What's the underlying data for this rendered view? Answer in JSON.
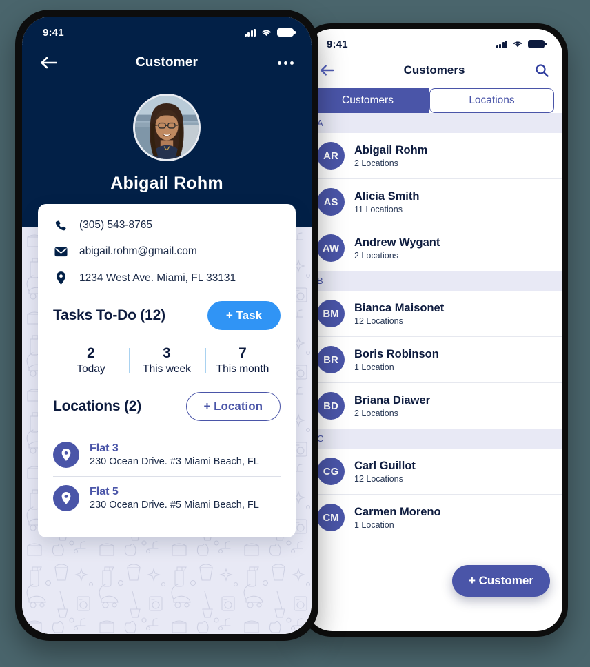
{
  "colors": {
    "page_background": "#4a656c",
    "navy": "#022047",
    "indigo": "#4a55a8",
    "bright_blue": "#3094f5",
    "section_header_bg": "#e8e9f5"
  },
  "detail_phone": {
    "status_bar": {
      "time": "9:41",
      "signal_icon": "cellular-bars-icon",
      "wifi_icon": "wifi-icon",
      "battery_icon": "battery-icon"
    },
    "nav": {
      "back_icon": "arrow-left-icon",
      "title": "Customer",
      "more_icon": "more-options-icon"
    },
    "profile": {
      "avatar": "customer-photo",
      "name": "Abigail Rohm"
    },
    "contact": [
      {
        "icon": "phone-icon",
        "value": "(305) 543-8765"
      },
      {
        "icon": "mail-icon",
        "value": "abigail.rohm@gmail.com"
      },
      {
        "icon": "location-pin-icon",
        "value": "1234 West Ave. Miami, FL 33131"
      }
    ],
    "tasks": {
      "title": "Tasks To-Do (12)",
      "add_label": "+ Task",
      "stats": [
        {
          "value": "2",
          "label": "Today"
        },
        {
          "value": "3",
          "label": "This week"
        },
        {
          "value": "7",
          "label": "This month"
        }
      ]
    },
    "locations": {
      "title": "Locations (2)",
      "add_label": "+ Location",
      "items": [
        {
          "name": "Flat 3",
          "address": "230 Ocean Drive. #3 Miami Beach, FL"
        },
        {
          "name": "Flat 5",
          "address": "230 Ocean Drive. #5 Miami Beach, FL"
        }
      ]
    }
  },
  "list_phone": {
    "status_bar": {
      "time": "9:41",
      "signal_icon": "cellular-bars-icon",
      "wifi_icon": "wifi-icon",
      "battery_icon": "battery-icon"
    },
    "nav": {
      "back_icon": "arrow-left-icon",
      "title": "Customers",
      "search_icon": "search-icon"
    },
    "tabs": [
      {
        "label": "Customers",
        "active": true
      },
      {
        "label": "Locations",
        "active": false
      }
    ],
    "sections": [
      {
        "letter": "A",
        "customers": [
          {
            "initials": "AR",
            "name": "Abigail Rohm",
            "subtitle": "2 Locations"
          },
          {
            "initials": "AS",
            "name": "Alicia Smith",
            "subtitle": "11 Locations"
          },
          {
            "initials": "AW",
            "name": "Andrew Wygant",
            "subtitle": "2 Locations"
          }
        ]
      },
      {
        "letter": "B",
        "customers": [
          {
            "initials": "BM",
            "name": "Bianca Maisonet",
            "subtitle": "12 Locations"
          },
          {
            "initials": "BR",
            "name": "Boris Robinson",
            "subtitle": "1 Location"
          },
          {
            "initials": "BD",
            "name": "Briana Diawer",
            "subtitle": "2 Locations"
          }
        ]
      },
      {
        "letter": "C",
        "customers": [
          {
            "initials": "CG",
            "name": "Carl Guillot",
            "subtitle": "12 Locations"
          },
          {
            "initials": "CM",
            "name": "Carmen Moreno",
            "subtitle": "1 Location"
          }
        ]
      }
    ],
    "fab_label": "+ Customer"
  }
}
